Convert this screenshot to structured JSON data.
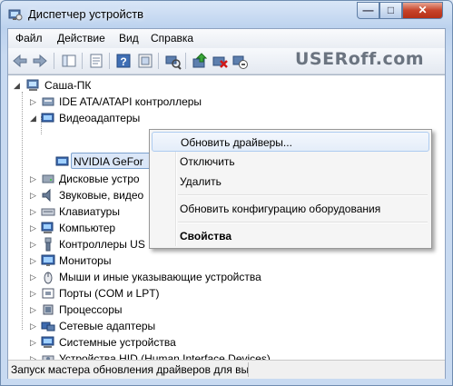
{
  "window": {
    "title": "Диспетчер устройств",
    "buttons": {
      "minimize": "—",
      "maximize": "□",
      "close": "✕"
    }
  },
  "menu": [
    "Файл",
    "Действие",
    "Вид",
    "Справка"
  ],
  "logo": {
    "text": "USERoff.com"
  },
  "tree": {
    "root": "Саша-ПК",
    "items": [
      {
        "label": "IDE ATA/ATAPI контроллеры",
        "icon": "ide-controller-icon"
      },
      {
        "label": "Видеоадаптеры",
        "icon": "display-adapter-icon"
      },
      {
        "label": "NVIDIA GeFor",
        "icon": "video-card-icon"
      },
      {
        "label": "Дисковые устро",
        "icon": "disk-drive-icon"
      },
      {
        "label": "Звуковые, видео",
        "icon": "sound-icon"
      },
      {
        "label": "Клавиатуры",
        "icon": "keyboard-icon"
      },
      {
        "label": "Компьютер",
        "icon": "computer-icon"
      },
      {
        "label": "Контроллеры US",
        "icon": "usb-icon"
      },
      {
        "label": "Мониторы",
        "icon": "monitor-icon"
      },
      {
        "label": "Мыши и иные указывающие устройства",
        "icon": "mouse-icon"
      },
      {
        "label": "Порты (COM и LPT)",
        "icon": "port-icon"
      },
      {
        "label": "Процессоры",
        "icon": "processor-icon"
      },
      {
        "label": "Сетевые адаптеры",
        "icon": "network-icon"
      },
      {
        "label": "Системные устройства",
        "icon": "system-icon"
      },
      {
        "label": "Устройства HID (Human Interface Devices)",
        "icon": "hid-icon"
      }
    ]
  },
  "context_menu": {
    "update": "Обновить драйверы...",
    "disable": "Отключить",
    "delete": "Удалить",
    "scan": "Обновить конфигурацию оборудования",
    "properties": "Свойства"
  },
  "status": {
    "text": "Запуск мастера обновления драйверов для вы"
  }
}
